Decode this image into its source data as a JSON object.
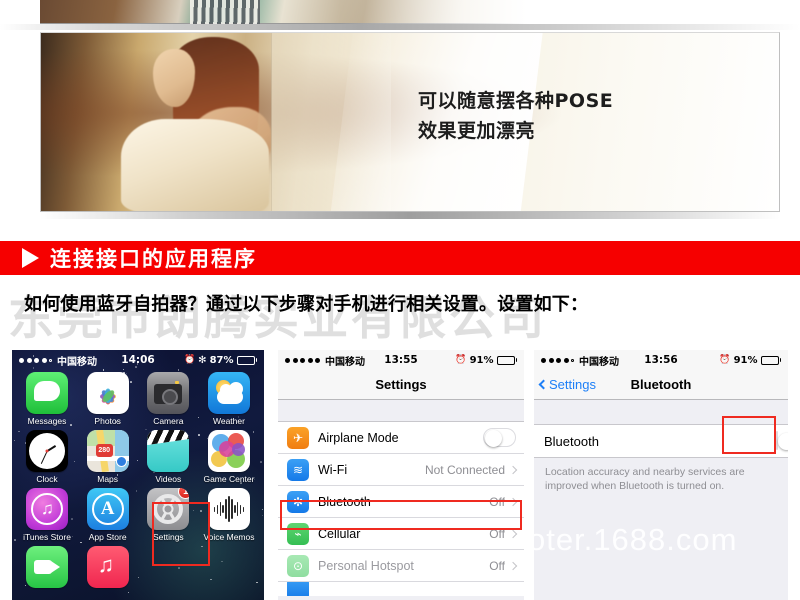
{
  "hero": {
    "caption": "可以随意摆各种POSE\n效果更加漂亮",
    "alt_top_strip": "fashion-photo-strip",
    "alt_main": "woman-posing-photo"
  },
  "section_banner": {
    "title": "连接接口的应用程序",
    "bg_color": "#f60000",
    "marker": "triangle-right"
  },
  "watermarks": {
    "company": "东莞市朗腾实业有限公司",
    "site": "oter.1688.com"
  },
  "intro": {
    "text": "如何使用蓝牙自拍器？通过以下步骤对手机进行相关设置。设置如下："
  },
  "screens": {
    "home": {
      "status": {
        "signal_filled": 4,
        "signal_empty": 1,
        "carrier": "中国移动",
        "time": "14:06",
        "alarm_icon": "⏰",
        "bluetooth_icon": "✻",
        "battery_text": "87%",
        "battery_level": 87
      },
      "rows": [
        [
          {
            "label": "Messages",
            "icon": "messages-icon"
          },
          {
            "label": "Photos",
            "icon": "photos-icon"
          },
          {
            "label": "Camera",
            "icon": "camera-icon"
          },
          {
            "label": "Weather",
            "icon": "weather-icon"
          }
        ],
        [
          {
            "label": "Clock",
            "icon": "clock-icon"
          },
          {
            "label": "Maps",
            "icon": "maps-icon"
          },
          {
            "label": "Videos",
            "icon": "videos-icon"
          },
          {
            "label": "Game Center",
            "icon": "game-center-icon"
          }
        ],
        [
          {
            "label": "iTunes Store",
            "icon": "itunes-store-icon"
          },
          {
            "label": "App Store",
            "icon": "app-store-icon"
          },
          {
            "label": "Settings",
            "icon": "settings-icon",
            "badge": "1",
            "highlighted": true
          },
          {
            "label": "Voice Memos",
            "icon": "voice-memos-icon"
          }
        ],
        [
          {
            "label": "",
            "icon": "facetime-icon"
          },
          {
            "label": "",
            "icon": "music-icon"
          }
        ]
      ],
      "maps_shield_label": "280"
    },
    "settings": {
      "status": {
        "signal_filled": 5,
        "signal_empty": 0,
        "carrier": "中国移动",
        "time": "13:55",
        "alarm_icon": "⏰",
        "battery_text": "91%",
        "battery_level": 91
      },
      "nav_title": "Settings",
      "items": [
        {
          "label": "Airplane Mode",
          "icon": "airplane-icon",
          "glyph": "✈",
          "control": "toggle",
          "value": "",
          "enabled": true
        },
        {
          "label": "Wi-Fi",
          "icon": "wifi-icon",
          "glyph": "≋",
          "control": "chevron",
          "value": "Not Connected",
          "enabled": true
        },
        {
          "label": "Bluetooth",
          "icon": "bluetooth-icon",
          "glyph": "✻",
          "control": "chevron",
          "value": "Off",
          "enabled": true,
          "highlighted": true
        },
        {
          "label": "Cellular",
          "icon": "cellular-icon",
          "glyph": "⌁",
          "control": "chevron",
          "value": "Off",
          "enabled": true
        },
        {
          "label": "Personal Hotspot",
          "icon": "hotspot-icon",
          "glyph": "⊙",
          "control": "chevron",
          "value": "Off",
          "enabled": false
        }
      ]
    },
    "bluetooth": {
      "status": {
        "signal_filled": 4,
        "signal_empty": 1,
        "carrier": "中国移动",
        "time": "13:56",
        "alarm_icon": "⏰",
        "battery_text": "91%",
        "battery_level": 91
      },
      "back_label": "Settings",
      "nav_title": "Bluetooth",
      "row_label": "Bluetooth",
      "toggle_state": "off",
      "note": "Location accuracy and nearby services are improved when Bluetooth is turned on."
    }
  },
  "colors": {
    "accent_red": "#f60000",
    "highlight_red": "#ef2a20",
    "ios_blue": "#1d7ff7",
    "gray_text": "#8e8e93"
  }
}
